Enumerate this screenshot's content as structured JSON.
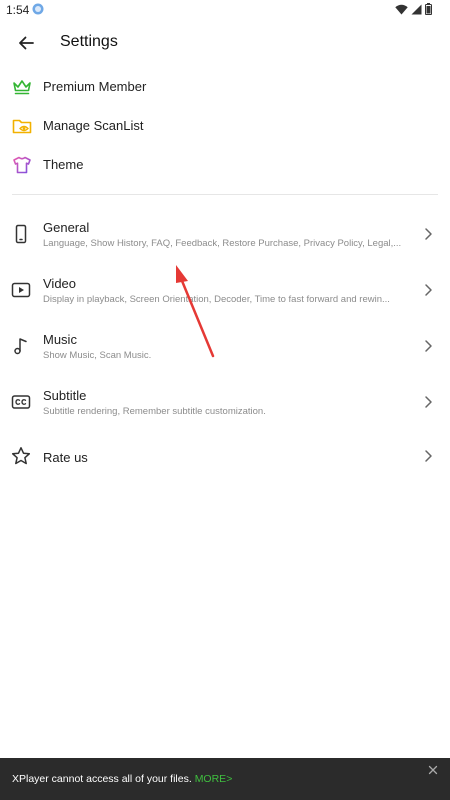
{
  "status_bar": {
    "time": "1:54",
    "app_icon": "blue-circle-app-icon",
    "wifi_icon": "wifi-icon",
    "signal_icon": "signal-icon",
    "battery_icon": "battery-icon"
  },
  "header": {
    "back_icon": "arrow-left-icon",
    "title": "Settings"
  },
  "top_items": [
    {
      "label": "Premium Member",
      "icon": "crown-icon",
      "color": "#33b533"
    },
    {
      "label": "Manage ScanList",
      "icon": "folder-eye-icon",
      "color": "#f2b100"
    },
    {
      "label": "Theme",
      "icon": "tshirt-icon",
      "color": "#b04fe0"
    }
  ],
  "settings": [
    {
      "title": "General",
      "description": "Language, Show History, FAQ, Feedback, Restore Purchase, Privacy Policy, Legal,...",
      "icon": "phone-icon"
    },
    {
      "title": "Video",
      "description": "Display in playback, Screen Orientation, Decoder, Time to fast forward and rewin...",
      "icon": "video-icon"
    },
    {
      "title": "Music",
      "description": "Show Music, Scan Music.",
      "icon": "music-note-icon"
    },
    {
      "title": "Subtitle",
      "description": "Subtitle rendering, Remember subtitle customization.",
      "icon": "cc-icon"
    },
    {
      "title": "Rate us",
      "description": "",
      "icon": "star-icon"
    }
  ],
  "annotation": {
    "arrow_color": "#e53935"
  },
  "snackbar": {
    "message": "XPlayer cannot access all of your files.",
    "action": "MORE>",
    "action_color": "#3fbf3f",
    "close_icon": "close-icon"
  }
}
